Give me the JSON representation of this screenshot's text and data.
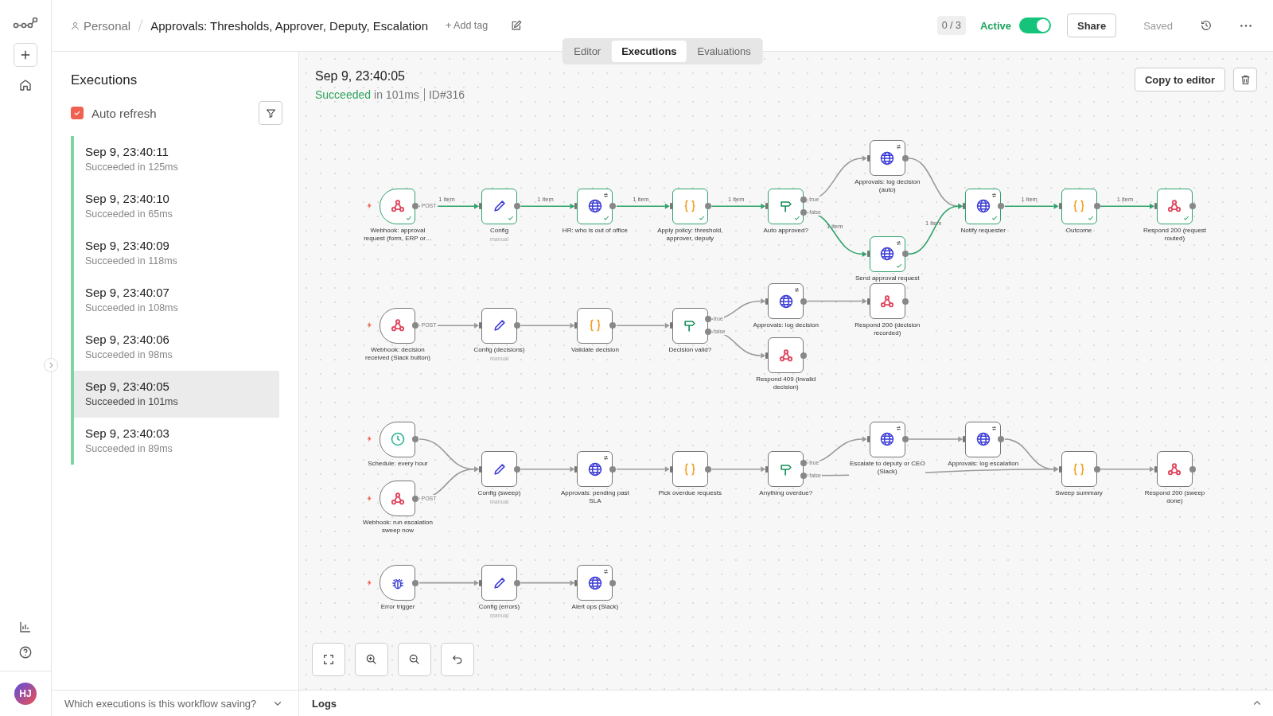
{
  "sidebar": {
    "avatar": "HJ"
  },
  "header": {
    "breadcrumb": "Personal",
    "title": "Approvals: Thresholds, Approver, Deputy, Escalation",
    "add_tag": "+ Add tag",
    "counter": "0 / 3",
    "active_label": "Active",
    "active": true,
    "share": "Share",
    "save_state": "Saved"
  },
  "tabs": [
    {
      "label": "Editor",
      "selected": false
    },
    {
      "label": "Executions",
      "selected": true
    },
    {
      "label": "Evaluations",
      "selected": false
    }
  ],
  "executions_panel": {
    "title": "Executions",
    "auto_refresh": {
      "label": "Auto refresh",
      "checked": true
    },
    "items": [
      {
        "time": "Sep 9, 23:40:11",
        "status": "Succeeded in 125ms",
        "selected": false
      },
      {
        "time": "Sep 9, 23:40:10",
        "status": "Succeeded in 65ms",
        "selected": false
      },
      {
        "time": "Sep 9, 23:40:09",
        "status": "Succeeded in 118ms",
        "selected": false
      },
      {
        "time": "Sep 9, 23:40:07",
        "status": "Succeeded in 108ms",
        "selected": false
      },
      {
        "time": "Sep 9, 23:40:06",
        "status": "Succeeded in 98ms",
        "selected": false
      },
      {
        "time": "Sep 9, 23:40:05",
        "status": "Succeeded in 101ms",
        "selected": true
      },
      {
        "time": "Sep 9, 23:40:03",
        "status": "Succeeded in 89ms",
        "selected": false
      }
    ],
    "footer": "Which executions is this workflow saving?"
  },
  "execution": {
    "time": "Sep 9, 23:40:05",
    "status": "Succeeded",
    "duration": "in 101ms",
    "id": "ID#316",
    "copy_button": "Copy to editor"
  },
  "workflow": {
    "nodes": [
      {
        "label": "Webhook: approval request (form, ERP or…",
        "kind": "webhook",
        "trigger": true,
        "executed": true,
        "outputs": [
          "POST"
        ]
      },
      {
        "label": "Config",
        "subtitle": "manual",
        "kind": "set",
        "trigger": false,
        "executed": true
      },
      {
        "label": "HR: who is out of office",
        "kind": "http",
        "trigger": false,
        "executed": true
      },
      {
        "label": "Apply policy: threshold, approver, deputy",
        "kind": "code",
        "trigger": false,
        "executed": true
      },
      {
        "label": "Auto approved?",
        "kind": "if",
        "trigger": false,
        "executed": true,
        "outputs": [
          "true",
          "false"
        ]
      },
      {
        "label": "Approvals: log decision (auto)",
        "kind": "http",
        "trigger": false,
        "executed": false
      },
      {
        "label": "Send approval request",
        "kind": "http",
        "trigger": false,
        "executed": true
      },
      {
        "label": "Notify requester",
        "kind": "http",
        "trigger": false,
        "executed": true
      },
      {
        "label": "Outcome",
        "kind": "code",
        "trigger": false,
        "executed": true
      },
      {
        "label": "Respond 200 (request routed)",
        "kind": "webhook",
        "trigger": false,
        "executed": true
      },
      {
        "label": "Webhook: decision received (Slack button)",
        "kind": "webhook",
        "trigger": true,
        "executed": false,
        "outputs": [
          "POST"
        ]
      },
      {
        "label": "Config (decisions)",
        "subtitle": "manual",
        "kind": "set",
        "trigger": false,
        "executed": false
      },
      {
        "label": "Validate decision",
        "kind": "code",
        "trigger": false,
        "executed": false
      },
      {
        "label": "Decision valid?",
        "kind": "if",
        "trigger": false,
        "executed": false,
        "outputs": [
          "true",
          "false"
        ]
      },
      {
        "label": "Approvals: log decision",
        "kind": "http",
        "trigger": false,
        "executed": false
      },
      {
        "label": "Respond 200 (decision recorded)",
        "kind": "webhook",
        "trigger": false,
        "executed": false
      },
      {
        "label": "Respond 409 (invalid decision)",
        "kind": "webhook",
        "trigger": false,
        "executed": false
      },
      {
        "label": "Schedule: every hour",
        "kind": "schedule",
        "trigger": true,
        "executed": false
      },
      {
        "label": "Webhook: run escalation sweep now",
        "kind": "webhook",
        "trigger": true,
        "executed": false,
        "outputs": [
          "POST"
        ]
      },
      {
        "label": "Config (sweep)",
        "subtitle": "manual",
        "kind": "set",
        "trigger": false,
        "executed": false
      },
      {
        "label": "Approvals: pending past SLA",
        "kind": "http",
        "trigger": false,
        "executed": false
      },
      {
        "label": "Pick overdue requests",
        "kind": "code",
        "trigger": false,
        "executed": false
      },
      {
        "label": "Anything overdue?",
        "kind": "if",
        "trigger": false,
        "executed": false,
        "outputs": [
          "true",
          "false"
        ]
      },
      {
        "label": "Escalate to deputy or CEO (Slack)",
        "kind": "http",
        "trigger": false,
        "executed": false
      },
      {
        "label": "Approvals: log escalation",
        "kind": "http",
        "trigger": false,
        "executed": false
      },
      {
        "label": "Sweep summary",
        "kind": "code",
        "trigger": false,
        "executed": false
      },
      {
        "label": "Respond 200 (sweep done)",
        "kind": "webhook",
        "trigger": false,
        "executed": false
      },
      {
        "label": "Error trigger",
        "kind": "error",
        "trigger": true,
        "executed": false
      },
      {
        "label": "Config (errors)",
        "subtitle": "manual",
        "kind": "set",
        "trigger": false,
        "executed": false
      },
      {
        "label": "Alert ops (Slack)",
        "kind": "http",
        "trigger": false,
        "executed": false
      }
    ],
    "connections": [
      {
        "executed": true,
        "label": "1 item"
      },
      {
        "executed": true,
        "label": "1 item"
      },
      {
        "executed": true,
        "label": "1 item"
      },
      {
        "executed": true,
        "label": "1 item"
      },
      {
        "executed": false
      },
      {
        "executed": true,
        "label": "1 item"
      },
      {
        "executed": false
      },
      {
        "executed": true,
        "label": "1 item"
      },
      {
        "executed": true,
        "label": "1 item"
      },
      {
        "executed": true,
        "label": "1 item"
      },
      {
        "executed": false
      },
      {
        "executed": false
      },
      {
        "executed": false
      },
      {
        "executed": false
      },
      {
        "executed": false
      },
      {
        "executed": false
      },
      {
        "executed": false
      },
      {
        "executed": false
      },
      {
        "executed": false
      },
      {
        "executed": false
      },
      {
        "executed": false
      },
      {
        "executed": false
      },
      {
        "executed": false
      },
      {
        "executed": false
      },
      {
        "executed": false
      },
      {
        "executed": false
      },
      {
        "executed": false
      },
      {
        "executed": false
      }
    ]
  },
  "logs": {
    "title": "Logs"
  }
}
